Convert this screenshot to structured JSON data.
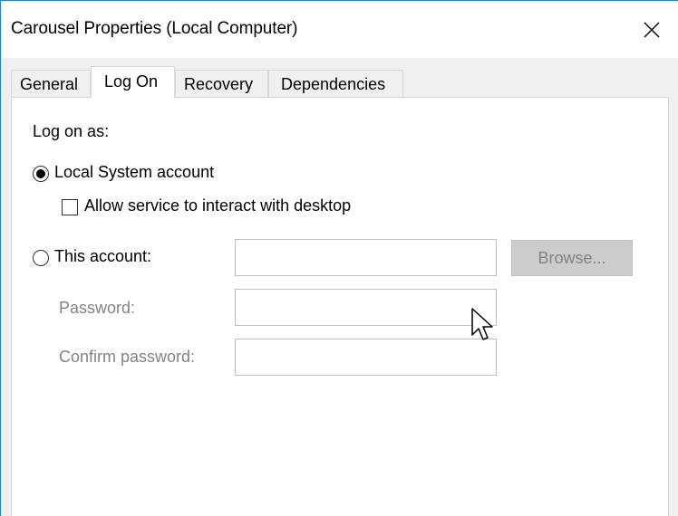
{
  "window": {
    "title": "Carousel Properties (Local Computer)"
  },
  "tabs": [
    {
      "label": "General",
      "active": false
    },
    {
      "label": "Log On",
      "active": true
    },
    {
      "label": "Recovery",
      "active": false
    },
    {
      "label": "Dependencies",
      "active": false
    }
  ],
  "logon": {
    "section_label": "Log on as:",
    "local_system_label": "Local System account",
    "local_system_selected": true,
    "interact_desktop_label": "Allow service to interact with desktop",
    "interact_desktop_checked": false,
    "this_account_label": "This account:",
    "this_account_selected": false,
    "account_value": "",
    "password_label": "Password:",
    "password_value": "",
    "confirm_password_label": "Confirm password:",
    "confirm_password_value": "",
    "browse_label": "Browse..."
  },
  "icons": {
    "close": "close-icon",
    "cursor": "mouse-pointer-icon"
  }
}
